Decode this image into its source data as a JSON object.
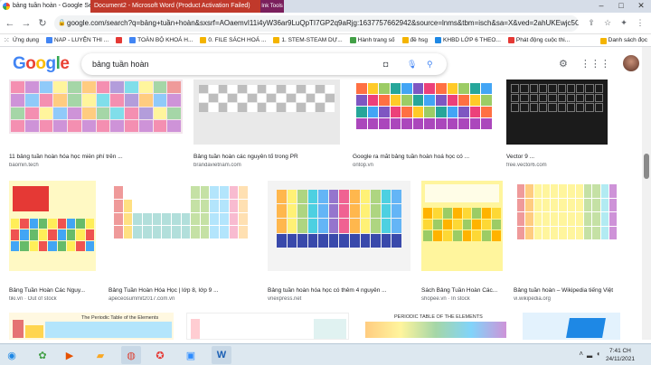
{
  "browser": {
    "tab_title": "bảng tuần hoàn - Google Search",
    "window_title": "Document2 - Microsoft Word (Product Activation Failed)",
    "ink_tools": "Ink Tools",
    "url": "google.com/search?q=bảng+tuần+hoàn&sxsrf=AOaemvI11i4yW36ar9LuQpTI7GP2q9aRjg:1637757662942&source=lnms&tbm=isch&sa=X&ved=2ahUKEwjc5OjdgrH0..."
  },
  "bookmarks": [
    {
      "label": "Ứng dụng",
      "kind": "apps"
    },
    {
      "label": "NAP - LUYỆN THI ...",
      "kind": "site"
    },
    {
      "label": "",
      "kind": "site"
    },
    {
      "label": "TOÀN BỘ KHOÁ H...",
      "kind": "site"
    },
    {
      "label": "0. FILE SÁCH HOÁ ...",
      "kind": "fold"
    },
    {
      "label": "1. STEM-STEAM DỰ...",
      "kind": "fold"
    },
    {
      "label": "Hành trang số",
      "kind": "site"
    },
    {
      "label": "đề hsg",
      "kind": "fold"
    },
    {
      "label": "KHBD LỚP 6 THEO...",
      "kind": "site"
    },
    {
      "label": "Phát động cuộc thi...",
      "kind": "site"
    }
  ],
  "bookmarks_right": "Danh sách đọc",
  "google": {
    "logo": "Google",
    "query": "bảng tuần hoàn"
  },
  "results_row1": [
    {
      "caption": "11 bảng tuần hoàn hóa học miễn phí trên ...",
      "source": "baomin.tech"
    },
    {
      "caption": "Bảng tuần hoàn các nguyên tố trong PR",
      "source": "brandavietnam.com"
    },
    {
      "caption": "Google ra mắt bảng tuần hoàn hoá học có ...",
      "source": "ontop.vn"
    },
    {
      "caption": "Vector 9 ...",
      "source": "free.vector6.com"
    }
  ],
  "results_row2": [
    {
      "caption": "Bảng Tuần Hoàn Các Nguy...",
      "source": "tiki.vn · Out of stock"
    },
    {
      "caption": "Bảng Tuần Hoàn Hóa Học | lớp 8, lớp 9 ...",
      "source": "apeceosummit2017.com.vn"
    },
    {
      "caption": "Bảng tuần hoàn hóa học có thêm 4 nguyên ...",
      "source": "vnexpress.net"
    },
    {
      "caption": "Sách Bảng Tuần Hoàn Các...",
      "source": "shopee.vn · In stock"
    },
    {
      "caption": "Bảng tuần hoàn – Wikipedia tiếng Việt",
      "source": "vi.wikipedia.org"
    }
  ],
  "row3_titles": [
    "The Periodic Table of the Elements",
    "PERIODIC TABLE OF THE ELEMENTS"
  ],
  "taskbar": {
    "time": "7:41 CH",
    "date": "24/11/2021"
  }
}
